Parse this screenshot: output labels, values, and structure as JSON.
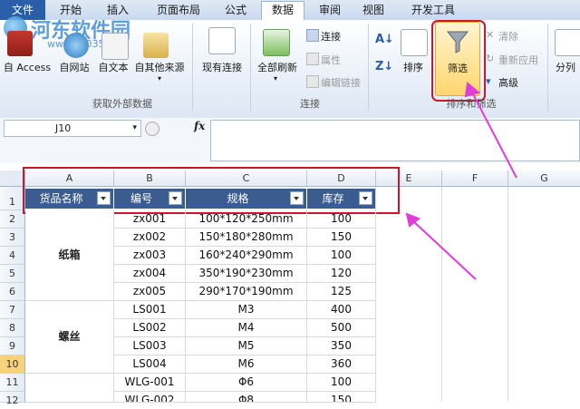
{
  "tabs": [
    "文件",
    "开始",
    "插入",
    "页面布局",
    "公式",
    "数据",
    "审阅",
    "视图",
    "开发工具"
  ],
  "watermark": {
    "title": "河东软件园",
    "url": "www.pc0359.cn"
  },
  "ribbon": {
    "get_external": {
      "buttons": [
        "自 Access",
        "自网站",
        "自文本",
        "自其他来源",
        "现有连接"
      ],
      "label": "获取外部数据"
    },
    "connections": {
      "refresh_all": "全部刷新",
      "connect": "连接",
      "properties": "属性",
      "edit_links": "编辑链接",
      "label": "连接"
    },
    "sort_filter": {
      "sort": "排序",
      "filter": "筛选",
      "clear": "清除",
      "reapply": "重新应用",
      "advanced": "高级",
      "label": "排序和筛选"
    },
    "split": "分列"
  },
  "formula_bar": {
    "name_box": "J10",
    "fx": "fx",
    "value": ""
  },
  "columns": [
    "A",
    "B",
    "C",
    "D",
    "E",
    "F",
    "G"
  ],
  "row_numbers": [
    "1",
    "2",
    "3",
    "4",
    "5",
    "6",
    "7",
    "8",
    "9",
    "10",
    "11",
    "12"
  ],
  "selected_row": "10",
  "headers": [
    "货品名称",
    "编号",
    "规格",
    "库存"
  ],
  "groups": [
    "纸箱",
    "螺丝"
  ],
  "rows": [
    {
      "code": "zx001",
      "spec": "100*120*250mm",
      "stock": "100"
    },
    {
      "code": "zx002",
      "spec": "150*180*280mm",
      "stock": "150"
    },
    {
      "code": "zx003",
      "spec": "160*240*290mm",
      "stock": "100"
    },
    {
      "code": "zx004",
      "spec": "350*190*230mm",
      "stock": "120"
    },
    {
      "code": "zx005",
      "spec": "290*170*190mm",
      "stock": "125"
    },
    {
      "code": "LS001",
      "spec": "M3",
      "stock": "400"
    },
    {
      "code": "LS002",
      "spec": "M4",
      "stock": "500"
    },
    {
      "code": "LS003",
      "spec": "M5",
      "stock": "350"
    },
    {
      "code": "LS004",
      "spec": "M6",
      "stock": "360"
    },
    {
      "code": "WLG-001",
      "spec": "Φ6",
      "stock": "100"
    },
    {
      "code": "WLG-002",
      "spec": "Φ8",
      "stock": "150"
    }
  ],
  "colors": {
    "accent": "#2a5ea8",
    "header_fill": "#3b5c8f",
    "highlight_box": "#c9172e",
    "arrow": "#e03cdc"
  }
}
